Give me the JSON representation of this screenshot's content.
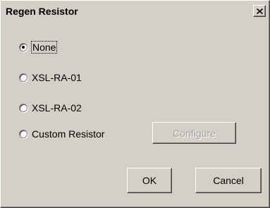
{
  "dialog": {
    "title": "Regen Resistor",
    "close_glyph": "✕"
  },
  "options": [
    {
      "label": "None",
      "selected": true
    },
    {
      "label": "XSL-RA-01",
      "selected": false
    },
    {
      "label": "XSL-RA-02",
      "selected": false
    },
    {
      "label": "Custom Resistor",
      "selected": false
    }
  ],
  "buttons": {
    "configure": "Configure",
    "ok": "OK",
    "cancel": "Cancel"
  }
}
